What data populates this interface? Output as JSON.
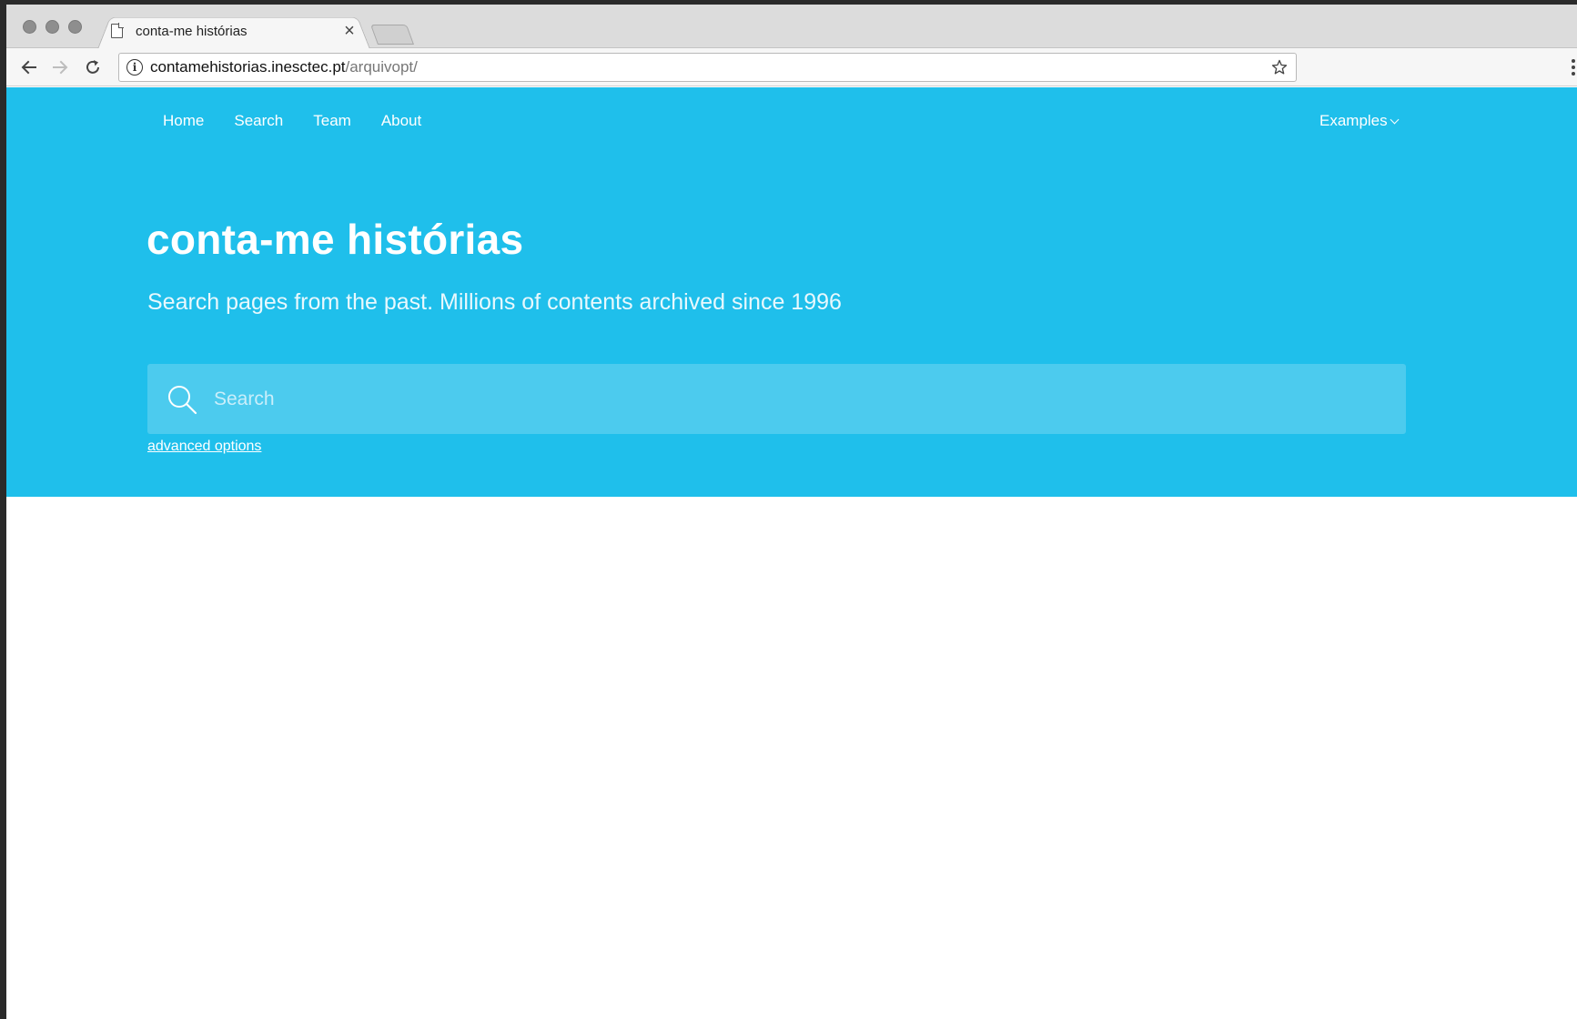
{
  "browser": {
    "tab": {
      "title": "conta-me histórias",
      "close_glyph": "×",
      "icon": "page-icon"
    },
    "address_bar": {
      "host": "contamehistorias.inesctec.pt",
      "path": "/arquivopt/",
      "info_icon": "i"
    }
  },
  "site": {
    "nav": {
      "items": [
        {
          "label": "Home"
        },
        {
          "label": "Search"
        },
        {
          "label": "Team"
        },
        {
          "label": "About"
        }
      ],
      "dropdown_label": "Examples"
    },
    "hero": {
      "title": "conta-me histórias",
      "tagline": "Search pages from the past. Millions of contents archived since 1996",
      "search_placeholder": "Search",
      "search_value": "",
      "advanced_link": "advanced options"
    },
    "colors": {
      "hero_background": "#1fbfeb",
      "search_background": "#4ccbee",
      "text": "#ffffff"
    }
  }
}
